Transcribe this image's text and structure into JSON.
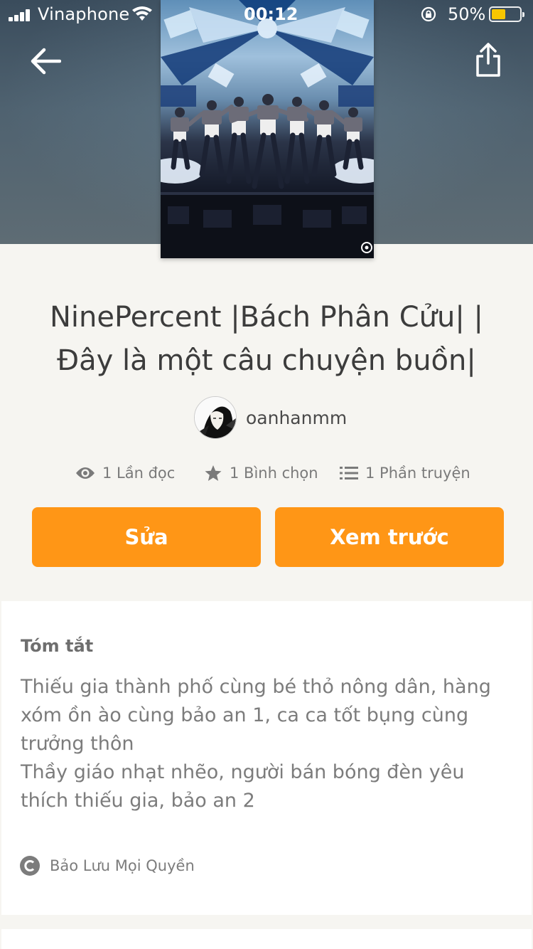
{
  "status_bar": {
    "carrier": "Vinaphone",
    "time": "00:12",
    "battery_percent": "50%",
    "battery_level": 0.5
  },
  "nav": {
    "back_icon": "arrow-left-icon",
    "share_icon": "share-icon"
  },
  "story": {
    "title": "NinePercent |Bách Phân Cửu| | Đây là một câu chuyện buồn|",
    "author": "oanhanmm"
  },
  "stats": {
    "reads": "1 Lần đọc",
    "votes": "1 Bình chọn",
    "parts": "1 Phần truyện"
  },
  "actions": {
    "edit_label": "Sửa",
    "preview_label": "Xem trước"
  },
  "summary": {
    "heading": "Tóm tắt",
    "lines": [
      "Thiếu gia thành phố cùng bé thỏ nông dân, hàng xóm ồn ào cùng bảo an 1, ca ca tốt bụng cùng trưởng thôn",
      "Thầy giáo nhạt nhẽo, người bán bóng đèn yêu thích thiếu gia, bảo an 2"
    ],
    "copyright": "Bảo Lưu Mọi Quyền"
  },
  "colors": {
    "accent": "#ff9616",
    "background": "#f6f5f1",
    "card": "#ffffff"
  }
}
